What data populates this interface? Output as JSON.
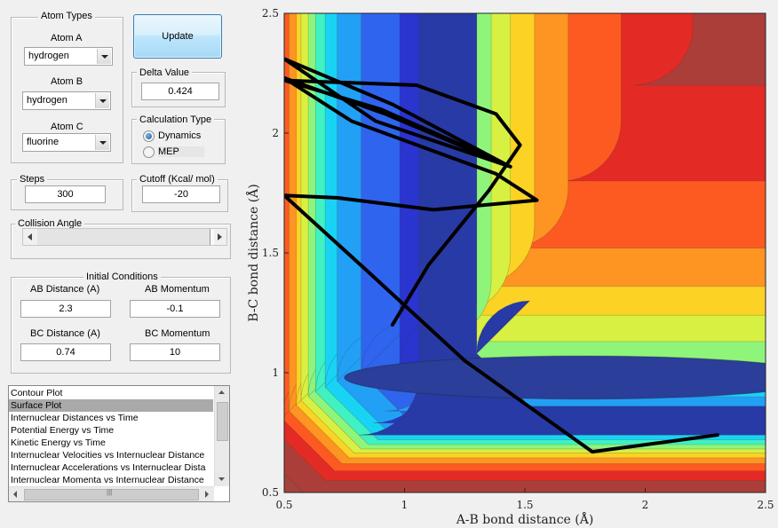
{
  "atom_types": {
    "title": "Atom Types",
    "atom_a": {
      "label": "Atom A",
      "value": "hydrogen"
    },
    "atom_b": {
      "label": "Atom B",
      "value": "hydrogen"
    },
    "atom_c": {
      "label": "Atom C",
      "value": "fluorine"
    }
  },
  "update_button": "Update",
  "delta": {
    "title": "Delta Value",
    "value": "0.424"
  },
  "calc_type": {
    "title": "Calculation Type",
    "options": [
      "Dynamics",
      "MEP"
    ],
    "selected": "Dynamics"
  },
  "steps": {
    "title": "Steps",
    "value": "300"
  },
  "cutoff": {
    "title": "Cutoff (Kcal/ mol)",
    "value": "-20"
  },
  "collision_angle": {
    "title": "Collision Angle"
  },
  "initial_conditions": {
    "title": "Initial Conditions",
    "ab_distance": {
      "label": "AB Distance (A)",
      "value": "2.3"
    },
    "ab_momentum": {
      "label": "AB Momentum",
      "value": "-0.1"
    },
    "bc_distance": {
      "label": "BC Distance (A)",
      "value": "0.74"
    },
    "bc_momentum": {
      "label": "BC Momentum",
      "value": "10"
    }
  },
  "plot_list": {
    "items": [
      "Contour Plot",
      "Surface Plot",
      "Internuclear Distances vs Time",
      "Potential Energy vs Time",
      "Kinetic Energy vs Time",
      "Internuclear Velocities vs Internuclear Distance",
      "Internuclear Accelerations vs Internuclear Dista",
      "Internuclear Momenta vs Internuclear Distance"
    ],
    "selected_index": 1
  },
  "chart_data": {
    "type": "contour",
    "xlabel": "A-B bond distance (Å)",
    "ylabel": "B-C bond distance (Å)",
    "xlim": [
      0.5,
      2.5
    ],
    "ylim": [
      0.5,
      2.5
    ],
    "xticks": [
      "0.5",
      "1",
      "1.5",
      "2",
      "2.5"
    ],
    "yticks": [
      "0.5",
      "1",
      "1.5",
      "2",
      "2.5"
    ],
    "colormap": "jet",
    "trajectory": [
      [
        2.3,
        0.74
      ],
      [
        1.78,
        0.67
      ],
      [
        1.25,
        1.05
      ],
      [
        0.85,
        1.42
      ],
      [
        0.5,
        1.74
      ],
      [
        0.72,
        1.73
      ],
      [
        1.12,
        1.68
      ],
      [
        1.55,
        1.72
      ],
      [
        1.38,
        1.83
      ],
      [
        0.78,
        2.05
      ],
      [
        0.5,
        2.23
      ],
      [
        0.92,
        2.08
      ],
      [
        1.44,
        1.86
      ],
      [
        0.88,
        2.05
      ],
      [
        0.5,
        2.31
      ],
      [
        0.95,
        2.12
      ],
      [
        1.42,
        1.87
      ],
      [
        0.9,
        2.1
      ],
      [
        0.5,
        2.22
      ],
      [
        1.05,
        2.2
      ],
      [
        1.38,
        2.08
      ],
      [
        1.48,
        1.95
      ],
      [
        1.35,
        1.76
      ],
      [
        1.1,
        1.45
      ],
      [
        0.95,
        1.2
      ]
    ]
  }
}
